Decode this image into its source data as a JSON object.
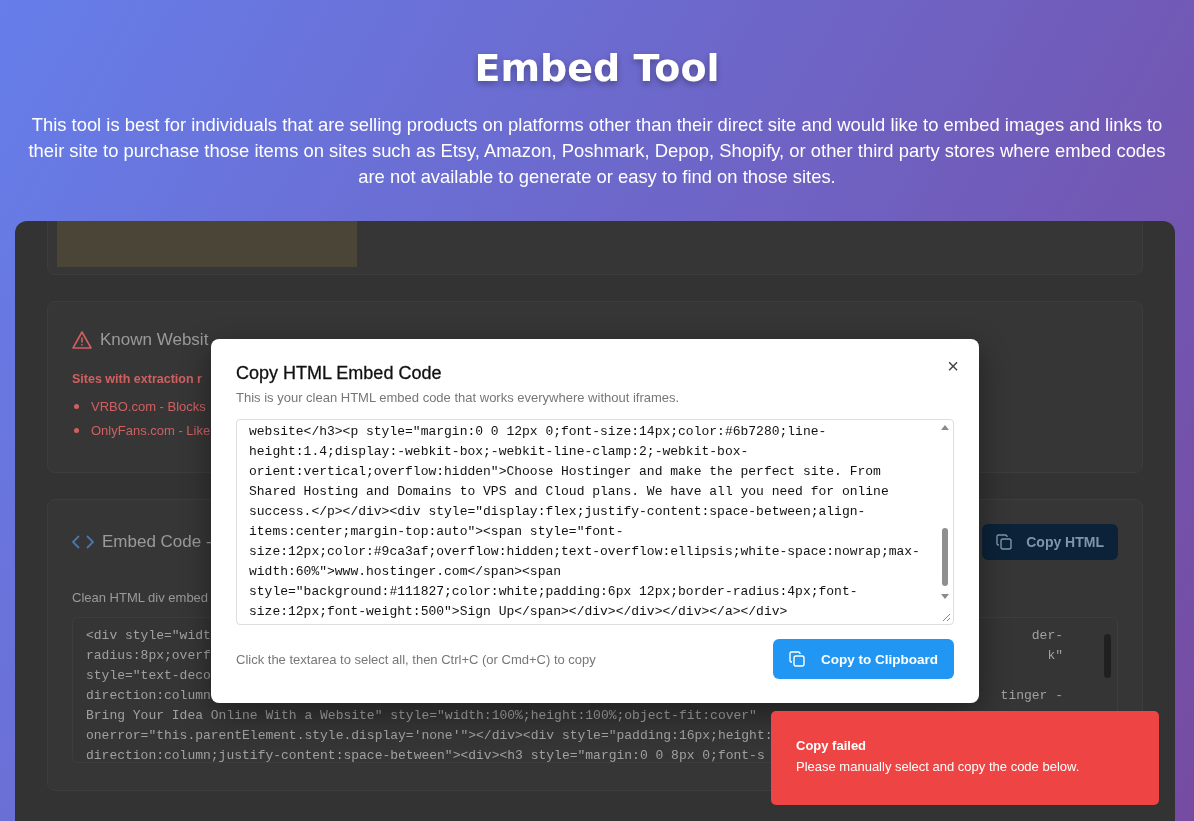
{
  "header": {
    "title": "Embed Tool",
    "description": "This tool is best for individuals that are selling products on platforms other than their direct site and would like to embed images and links to their site to purchase those items on sites such as Etsy, Amazon, Poshmark, Depop, Shopify, or other third party stores where embed codes are not available to generate or easy to find on those sites."
  },
  "issues_card": {
    "title": "Known Websit",
    "subtitle": "Sites with extraction r",
    "items": [
      "VRBO.com - Blocks",
      "OnlyFans.com - Like"
    ]
  },
  "embed_card": {
    "title": "Embed Code -",
    "button": "Copy HTML",
    "caption": "Clean HTML div embed",
    "code_lines": [
      {
        "left": "<div style=\"widt",
        "right": "der-"
      },
      {
        "left": "radius:8px;overf",
        "right": "k\""
      },
      {
        "left": "style=\"text-deco"
      },
      {
        "left": "direction:column",
        "right": "tinger -"
      },
      {
        "left": "Bring Your Idea Online With a Website\" style=\"width:100%;height:100%;object-fit:cover\""
      },
      {
        "left": "onerror=\"this.parentElement.style.display='none'\"></div><div style=\"padding:16px;height:"
      },
      {
        "left": "direction:column;justify-content:space-between\"><div><h3 style=\"margin:0 0 8px 0;font-s"
      }
    ]
  },
  "modal": {
    "title": "Copy HTML Embed Code",
    "subtitle": "This is your clean HTML embed code that works everywhere without iframes.",
    "close": "×",
    "code_lines": [
      "website</h3><p style=\"margin:0 0 12px 0;font-size:14px;color:#6b7280;line-",
      "height:1.4;display:-webkit-box;-webkit-line-clamp:2;-webkit-box-",
      "orient:vertical;overflow:hidden\">Choose Hostinger and make the perfect site. From",
      "Shared Hosting and Domains to VPS and Cloud plans. We have all you need for online",
      "success.</p></div><div style=\"display:flex;justify-content:space-between;align-",
      "items:center;margin-top:auto\"><span style=\"font-",
      "size:12px;color:#9ca3af;overflow:hidden;text-overflow:ellipsis;white-space:nowrap;max-",
      "width:60%\">www.hostinger.com</span><span",
      "style=\"background:#111827;color:white;padding:6px 12px;border-radius:4px;font-",
      "size:12px;font-weight:500\">Sign Up</span></div></div></div></a></div>"
    ],
    "hint": "Click the textarea to select all, then Ctrl+C (or Cmd+C) to copy",
    "button": "Copy to Clipboard"
  },
  "toast": {
    "title": "Copy failed",
    "message": "Please manually select and copy the code below."
  }
}
